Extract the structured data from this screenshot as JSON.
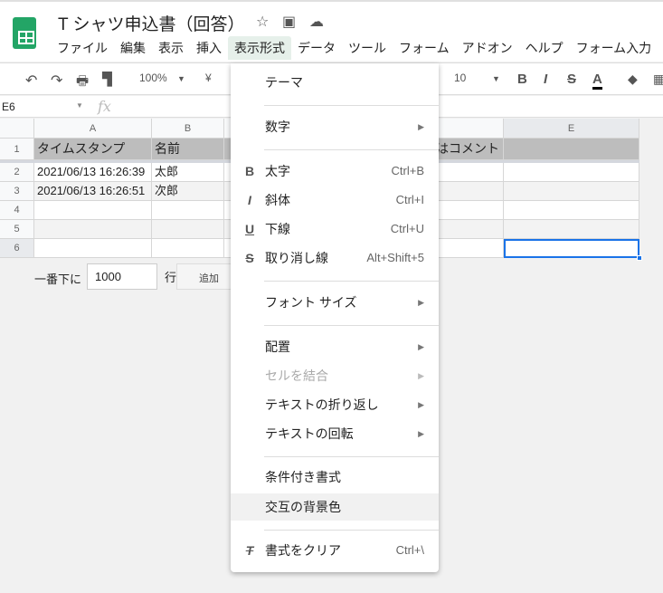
{
  "doc": {
    "title": "T シャツ申込書（回答）"
  },
  "menubar": [
    "ファイル",
    "編集",
    "表示",
    "挿入",
    "表示形式",
    "データ",
    "ツール",
    "フォーム",
    "アドオン",
    "ヘルプ",
    "フォーム入力"
  ],
  "toolbar": {
    "zoom": "100%",
    "currency": "¥",
    "font_size": "10"
  },
  "formula": {
    "cell_ref": "E6",
    "fx": "fx"
  },
  "grid": {
    "columns": [
      "A",
      "B",
      "E"
    ],
    "rows": [
      "1",
      "2",
      "3",
      "4",
      "5",
      "6"
    ],
    "header_row": {
      "a": "タイムスタンプ",
      "b": "名前",
      "d": "はコメント"
    },
    "data": [
      [
        "2021/06/13 16:26:39",
        "太郎"
      ],
      [
        "2021/06/13 16:26:51",
        "次郎"
      ]
    ]
  },
  "add_rows": {
    "prefix": "一番下に",
    "value": "1000",
    "suffix": "行",
    "button": "追加"
  },
  "menu": {
    "theme": "テーマ",
    "number": "数字",
    "bold": "太字",
    "bold_sc": "Ctrl+B",
    "italic": "斜体",
    "italic_sc": "Ctrl+I",
    "underline": "下線",
    "underline_sc": "Ctrl+U",
    "strike": "取り消し線",
    "strike_sc": "Alt+Shift+5",
    "font_size": "フォント サイズ",
    "align": "配置",
    "merge": "セルを結合",
    "wrap": "テキストの折り返し",
    "rotate": "テキストの回転",
    "conditional": "条件付き書式",
    "alternating": "交互の背景色",
    "clear": "書式をクリア",
    "clear_sc": "Ctrl+\\"
  }
}
